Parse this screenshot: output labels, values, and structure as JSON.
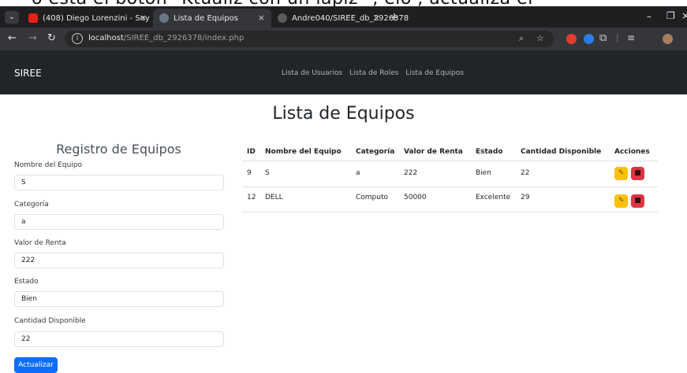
{
  "caption": {
    "text": "o esta el botón \"Ktualiz con un lapiz\" , elo , actualiza el"
  },
  "browser": {
    "tabs": [
      {
        "label": "(408) Diego Lorenzini - Soy",
        "badge": "🔊",
        "close": "×"
      },
      {
        "label": "Lista de Equipos",
        "close": "×"
      },
      {
        "label": "Andre040/SIREE_db_2926378",
        "close": "×"
      }
    ],
    "new_tab": "+",
    "url_host": "localhost",
    "url_path": "/SIREE_db_2926378/index.php"
  },
  "navbar": {
    "brand": "SIREE",
    "links": [
      "Lista de Usuarios",
      "Lista de Roles",
      "Lista de Equipos"
    ]
  },
  "page": {
    "title": "Lista de Equipos"
  },
  "form": {
    "title": "Registro de Equipos",
    "fields": [
      {
        "label": "Nombre del Equipo",
        "value": "S"
      },
      {
        "label": "Categoría",
        "value": "a"
      },
      {
        "label": "Valor de Renta",
        "value": "222"
      },
      {
        "label": "Estado",
        "value": "Bien"
      },
      {
        "label": "Cantidad Disponible",
        "value": "22"
      }
    ],
    "submit_label": "Actualizar"
  },
  "table": {
    "headers": [
      "ID",
      "Nombre del Equipo",
      "Categoría",
      "Valor de Renta",
      "Estado",
      "Cantidad Disponible",
      "Acciones"
    ],
    "rows": [
      [
        "9",
        "S",
        "a",
        "222",
        "Bien",
        "22"
      ],
      [
        "12",
        "DELL",
        "Computo",
        "50000",
        "Excelente",
        "29"
      ]
    ]
  },
  "colors": {
    "navbar": "#212529",
    "primary": "#0d6efd",
    "warning": "#ffc107",
    "danger": "#dc3545"
  },
  "icons": {
    "edit": "pencil-square-icon",
    "delete": "trash-icon"
  }
}
